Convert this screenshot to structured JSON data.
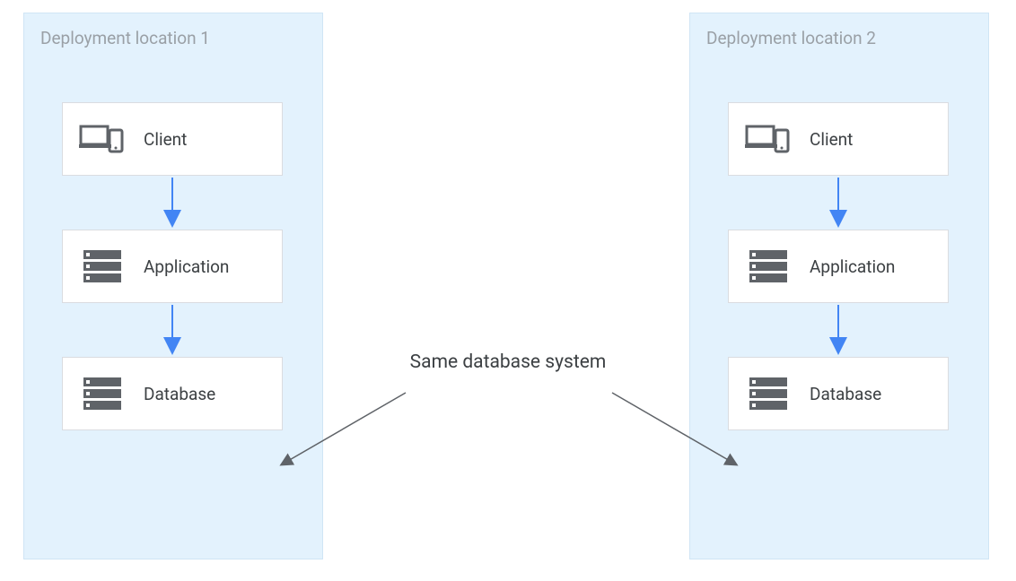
{
  "diagram": {
    "locations": [
      {
        "title": "Deployment location 1"
      },
      {
        "title": "Deployment location 2"
      }
    ],
    "nodes": {
      "client": "Client",
      "application": "Application",
      "database": "Database"
    },
    "center_annotation": "Same database system",
    "colors": {
      "panel_bg": "#e3f2fd",
      "arrow_blue": "#4285f4",
      "arrow_gray": "#5f6368",
      "text_muted": "#9aa0a6",
      "text_body": "#3c4043",
      "icon_gray": "#5f6368"
    }
  }
}
